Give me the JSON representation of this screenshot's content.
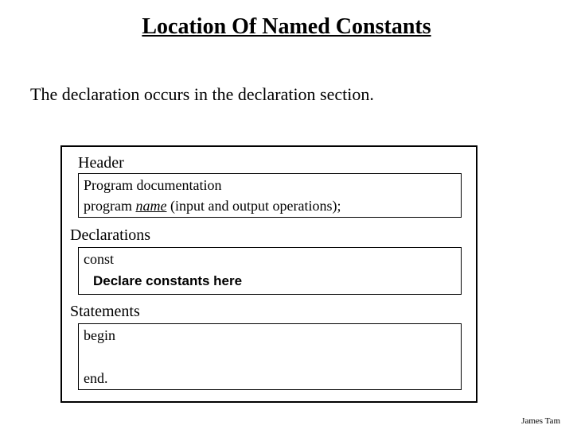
{
  "title": "Location Of Named Constants",
  "intro": "The declaration occurs in the declaration section.",
  "header": {
    "label": "Header",
    "doc": "Program documentation",
    "prog_prefix": "program ",
    "prog_name": "name",
    "prog_suffix": " (input and output operations);"
  },
  "declarations": {
    "label": "Declarations",
    "keyword": "const",
    "instruction": "Declare constants here"
  },
  "statements": {
    "label": "Statements",
    "begin": "begin",
    "end": "end."
  },
  "footer": "James Tam"
}
